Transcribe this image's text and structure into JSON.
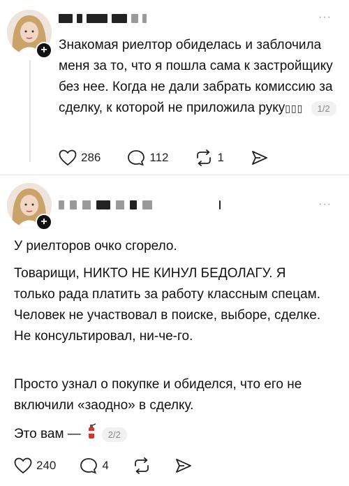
{
  "post1": {
    "username_hidden": true,
    "more_label": "···",
    "text": "Знакомая риелтор обиделась и заблочила меня за то, что я пошла сама к застройщику без нее. Когда не дали забрать комиссию за сделку, к которой не приложила руку",
    "emoji_placeholder": "▯▯▯",
    "pager": "1/2",
    "likes": "286",
    "comments": "112",
    "reposts": "1",
    "icons": [
      "heart-icon",
      "comment-icon",
      "repost-icon",
      "share-icon"
    ]
  },
  "post2": {
    "username_hidden": true,
    "more_label": "···",
    "paragraphs": [
      "У риелторов очко сгорело.",
      "Товарищи, НИКТО НЕ КИНУЛ БЕДОЛАГУ. Я только рада платить за работу классным спецам. Человек не участвовал в поиске, выборе, сделке. Не консультировал, ни-че-го.",
      "Просто узнал о покупке и обиделся, что его не включили «заодно» в сделку."
    ],
    "last_line": "Это вам —",
    "pager": "2/2",
    "likes": "240",
    "comments": "4",
    "icons": [
      "heart-icon",
      "comment-icon",
      "repost-icon",
      "share-icon",
      "fire-extinguisher-icon"
    ]
  }
}
